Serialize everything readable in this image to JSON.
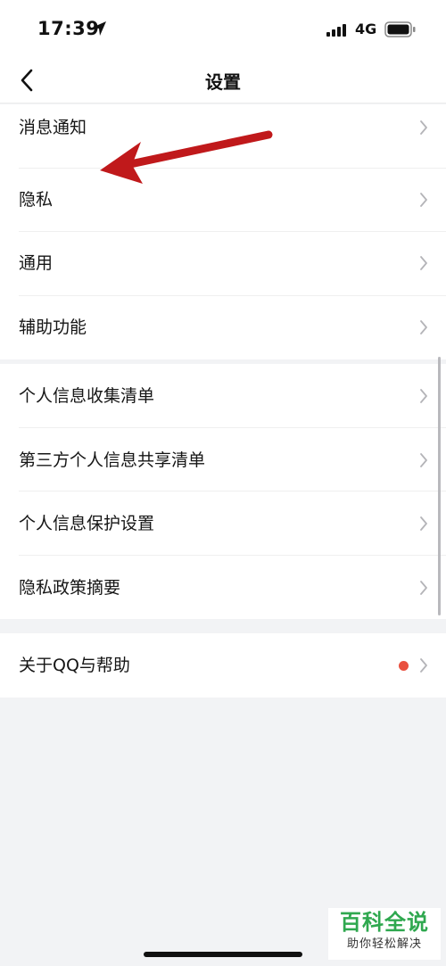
{
  "status": {
    "time": "17:39",
    "network": "4G",
    "location_icon": "location-arrow-icon",
    "signal_icon": "cellular-signal-icon",
    "battery_icon": "battery-icon"
  },
  "nav": {
    "title": "设置",
    "back_icon": "chevron-left-icon"
  },
  "groups": [
    {
      "items": [
        {
          "label": "消息通知"
        },
        {
          "label": "隐私"
        },
        {
          "label": "通用"
        },
        {
          "label": "辅助功能"
        }
      ]
    },
    {
      "items": [
        {
          "label": "个人信息收集清单"
        },
        {
          "label": "第三方个人信息共享清单"
        },
        {
          "label": "个人信息保护设置"
        },
        {
          "label": "隐私政策摘要"
        }
      ]
    },
    {
      "items": [
        {
          "label": "关于QQ与帮助",
          "badge_color": "#e9503f"
        }
      ]
    }
  ],
  "annotation": {
    "arrow_color": "#c0191b"
  },
  "watermark": {
    "main": "百科全说",
    "sub": "助你轻松解决",
    "color": "#2fa84f"
  }
}
